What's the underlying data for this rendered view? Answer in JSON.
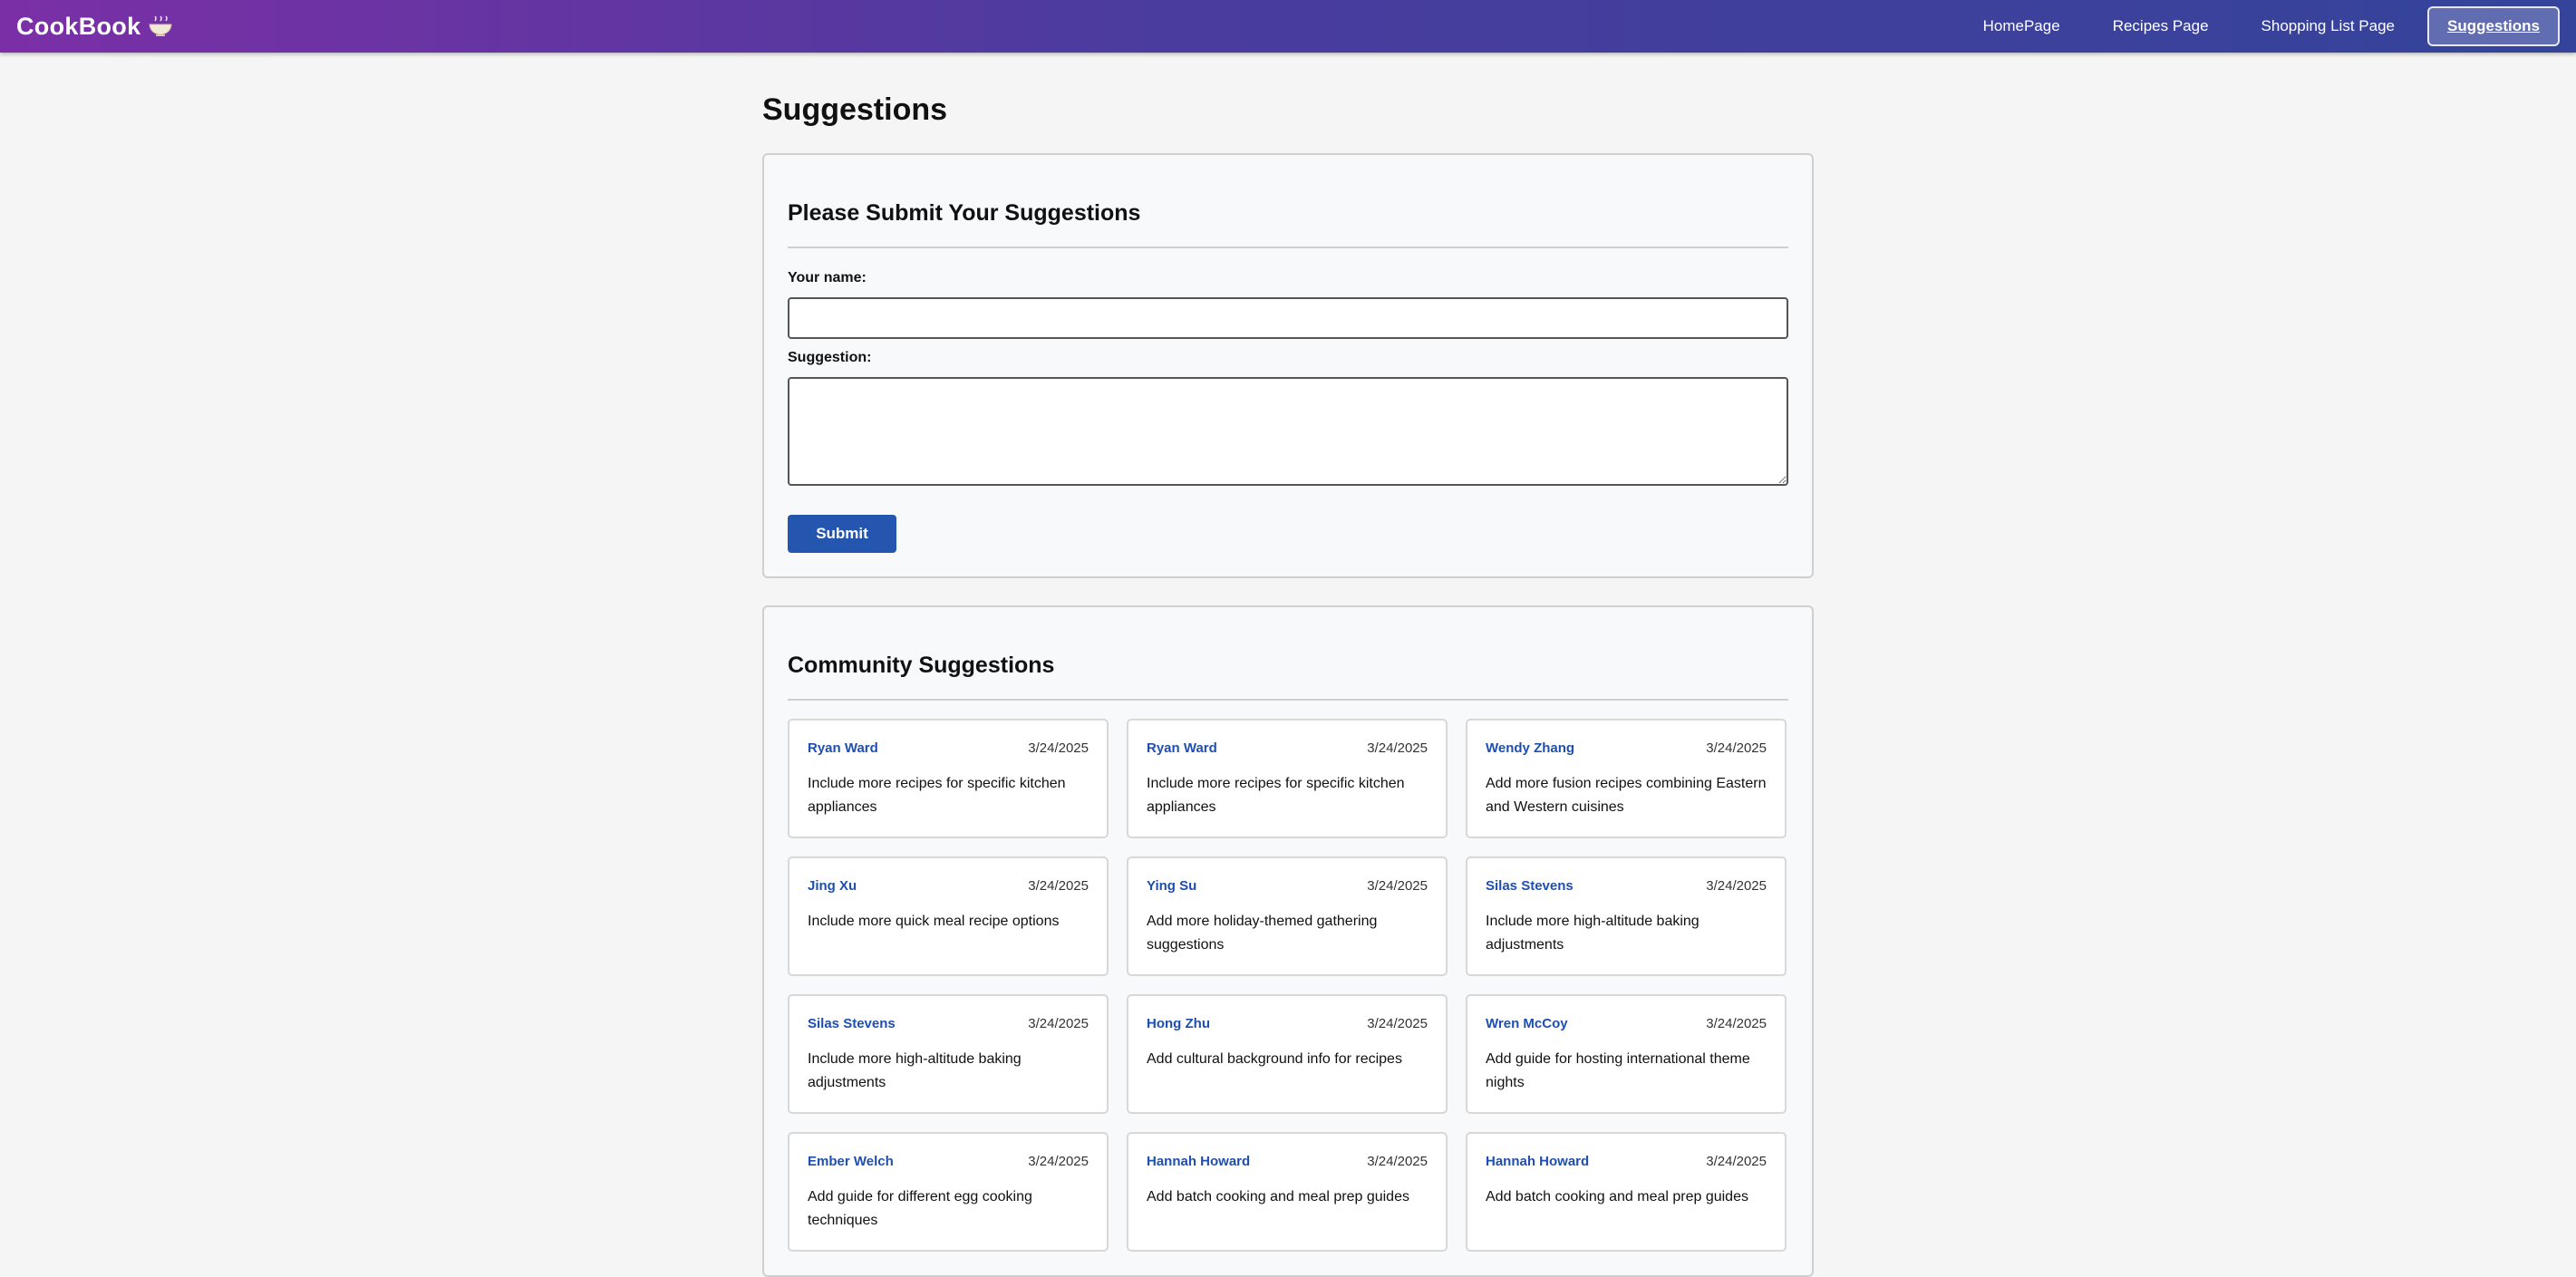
{
  "nav": {
    "brand": "CookBook",
    "links": [
      {
        "label": "HomePage"
      },
      {
        "label": "Recipes Page"
      },
      {
        "label": "Shopping List Page"
      },
      {
        "label": "Suggestions"
      }
    ],
    "active": "Suggestions"
  },
  "page": {
    "title": "Suggestions"
  },
  "form": {
    "title": "Please Submit Your Suggestions",
    "name_label": "Your name:",
    "name_value": "",
    "suggestion_label": "Suggestion:",
    "suggestion_value": "",
    "submit_label": "Submit"
  },
  "community": {
    "title": "Community Suggestions",
    "items": [
      {
        "name": "Ryan Ward",
        "date": "3/24/2025",
        "text": "Include more recipes for specific kitchen appliances"
      },
      {
        "name": "Ryan Ward",
        "date": "3/24/2025",
        "text": "Include more recipes for specific kitchen appliances"
      },
      {
        "name": "Wendy Zhang",
        "date": "3/24/2025",
        "text": "Add more fusion recipes combining Eastern and Western cuisines"
      },
      {
        "name": "Jing Xu",
        "date": "3/24/2025",
        "text": "Include more quick meal recipe options"
      },
      {
        "name": "Ying Su",
        "date": "3/24/2025",
        "text": "Add more holiday-themed gathering suggestions"
      },
      {
        "name": "Silas Stevens",
        "date": "3/24/2025",
        "text": "Include more high-altitude baking adjustments"
      },
      {
        "name": "Silas Stevens",
        "date": "3/24/2025",
        "text": "Include more high-altitude baking adjustments"
      },
      {
        "name": "Hong Zhu",
        "date": "3/24/2025",
        "text": "Add cultural background info for recipes"
      },
      {
        "name": "Wren McCoy",
        "date": "3/24/2025",
        "text": "Add guide for hosting international theme nights"
      },
      {
        "name": "Ember Welch",
        "date": "3/24/2025",
        "text": "Add guide for different egg cooking techniques"
      },
      {
        "name": "Hannah Howard",
        "date": "3/24/2025",
        "text": "Add batch cooking and meal prep guides"
      },
      {
        "name": "Hannah Howard",
        "date": "3/24/2025",
        "text": "Add batch cooking and meal prep guides"
      }
    ]
  },
  "colors": {
    "nav_gradient_start": "#7b2fa6",
    "nav_gradient_end": "#34449a",
    "accent": "#2456b0",
    "name_link": "#1e4fb0"
  },
  "icons": {
    "brand": "bowl-icon"
  }
}
